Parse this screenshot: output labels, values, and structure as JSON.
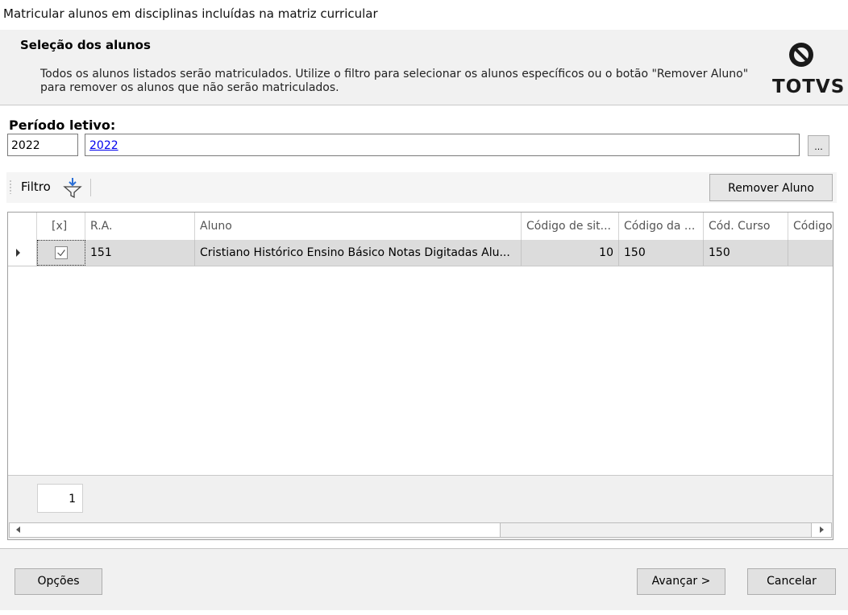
{
  "window": {
    "title": "Matricular alunos em disciplinas incluídas na matriz curricular"
  },
  "header": {
    "title": "Seleção dos alunos",
    "description": "Todos os alunos listados serão matriculados. Utilize o filtro para selecionar os alunos específicos ou o botão \"Remover Aluno\" para remover os alunos que não serão matriculados.",
    "logo_text": "TOTVS"
  },
  "period": {
    "label": "Período letivo:",
    "code": "2022",
    "link_text": "2022",
    "lookup_label": "..."
  },
  "toolbar": {
    "filter_label": "Filtro",
    "remove_button_label": "Remover Aluno"
  },
  "grid": {
    "columns": [
      "",
      "[x]",
      "R.A.",
      "Aluno",
      "Código de sit...",
      "Código da ...",
      "Cód. Curso",
      "Código"
    ],
    "rows": [
      {
        "checked": true,
        "ra": "151",
        "aluno": "Cristiano Histórico Ensino Básico Notas Digitadas Alu...",
        "codigo_sit": "10",
        "codigo_da": "150",
        "cod_curso": "150",
        "codigo": ""
      }
    ],
    "page_number": "1"
  },
  "footer": {
    "options_label": "Opções",
    "next_label": "Avançar >",
    "cancel_label": "Cancelar"
  }
}
